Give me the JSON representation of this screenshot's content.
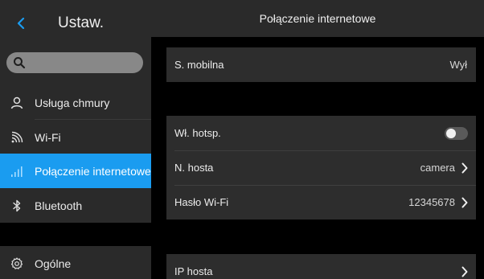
{
  "sidebar": {
    "title": "Ustaw.",
    "search": {
      "placeholder": ""
    },
    "items": [
      {
        "label": "Usługa chmury",
        "icon": "person-icon"
      },
      {
        "label": "Wi-Fi",
        "icon": "wifi-icon"
      },
      {
        "label": "Połączenie internetowe",
        "icon": "signal-icon",
        "active": true
      },
      {
        "label": "Bluetooth",
        "icon": "bluetooth-icon"
      },
      {
        "label": "Ogólne",
        "icon": "gear-icon"
      }
    ]
  },
  "main": {
    "title": "Połączenie internetowe",
    "mobile": {
      "label": "S. mobilna",
      "value": "Wył"
    },
    "hotspot": {
      "toggle_label": "Wł. hotsp.",
      "toggle_on": false,
      "host_name_label": "N. hosta",
      "host_name_value": "camera",
      "password_label": "Hasło Wi-Fi",
      "password_value": "12345678"
    },
    "host_ip": {
      "label": "IP hosta",
      "value": ""
    }
  },
  "colors": {
    "accent": "#1a9cf0",
    "sidebar_bg": "#2a2a2a",
    "card_bg": "#2d2d2d",
    "background": "#000000"
  }
}
